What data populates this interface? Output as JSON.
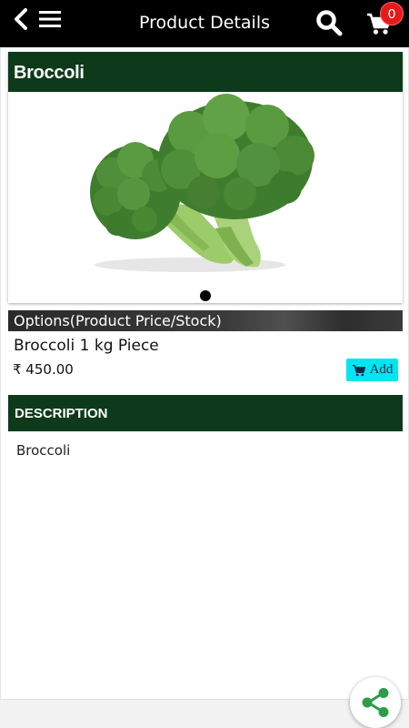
{
  "header": {
    "title": "Product Details",
    "cart_count": "0",
    "icons": [
      "back-arrow-icon",
      "menu-icon",
      "search-icon",
      "cart-icon"
    ]
  },
  "product": {
    "name": "Broccoli",
    "image_icon": "broccoli-image",
    "carousel_pages": 1
  },
  "options": {
    "label": "Options(Product Price/Stock)",
    "item_name": "Broccoli 1 kg Piece",
    "price": "₹ 450.00",
    "add_label": "Add"
  },
  "description": {
    "header": "DESCRIPTION",
    "text": "Broccoli"
  },
  "colors": {
    "header_green": "#0d3a1b",
    "add_button": "#00e6f0",
    "badge_red": "#e31b1b",
    "share_green": "#2e9c48"
  }
}
